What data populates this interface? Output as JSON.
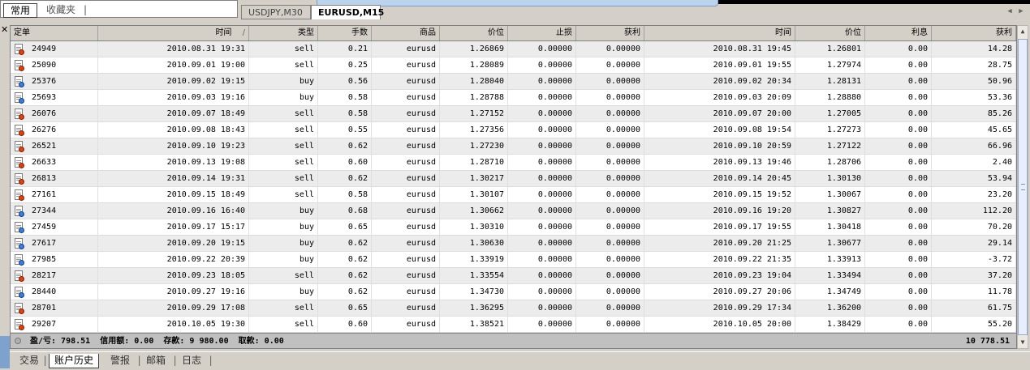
{
  "favorites_panel": {
    "tabs": [
      {
        "label": "常用"
      },
      {
        "label": "收藏夹"
      }
    ]
  },
  "chart_tabs": [
    {
      "label": "USDJPY,M30"
    },
    {
      "label": "EURUSD,M15"
    }
  ],
  "columns": [
    {
      "label": "定单"
    },
    {
      "label": "时间"
    },
    {
      "label": "类型"
    },
    {
      "label": "手数"
    },
    {
      "label": "商品"
    },
    {
      "label": "价位"
    },
    {
      "label": "止损"
    },
    {
      "label": "获利"
    },
    {
      "label": "时间"
    },
    {
      "label": "价位"
    },
    {
      "label": "利息"
    },
    {
      "label": "获利"
    }
  ],
  "sort_indicator": "/",
  "rows": [
    {
      "ticket": "24949",
      "open_time": "2010.08.31 19:31",
      "type": "sell",
      "lots": "0.21",
      "symbol": "eurusd",
      "open_price": "1.26869",
      "sl": "0.00000",
      "tp": "0.00000",
      "close_time": "2010.08.31 19:45",
      "close_price": "1.26801",
      "swap": "0.00",
      "profit": "14.28"
    },
    {
      "ticket": "25090",
      "open_time": "2010.09.01 19:00",
      "type": "sell",
      "lots": "0.25",
      "symbol": "eurusd",
      "open_price": "1.28089",
      "sl": "0.00000",
      "tp": "0.00000",
      "close_time": "2010.09.01 19:55",
      "close_price": "1.27974",
      "swap": "0.00",
      "profit": "28.75"
    },
    {
      "ticket": "25376",
      "open_time": "2010.09.02 19:15",
      "type": "buy",
      "lots": "0.56",
      "symbol": "eurusd",
      "open_price": "1.28040",
      "sl": "0.00000",
      "tp": "0.00000",
      "close_time": "2010.09.02 20:34",
      "close_price": "1.28131",
      "swap": "0.00",
      "profit": "50.96"
    },
    {
      "ticket": "25693",
      "open_time": "2010.09.03 19:16",
      "type": "buy",
      "lots": "0.58",
      "symbol": "eurusd",
      "open_price": "1.28788",
      "sl": "0.00000",
      "tp": "0.00000",
      "close_time": "2010.09.03 20:09",
      "close_price": "1.28880",
      "swap": "0.00",
      "profit": "53.36"
    },
    {
      "ticket": "26076",
      "open_time": "2010.09.07 18:49",
      "type": "sell",
      "lots": "0.58",
      "symbol": "eurusd",
      "open_price": "1.27152",
      "sl": "0.00000",
      "tp": "0.00000",
      "close_time": "2010.09.07 20:00",
      "close_price": "1.27005",
      "swap": "0.00",
      "profit": "85.26"
    },
    {
      "ticket": "26276",
      "open_time": "2010.09.08 18:43",
      "type": "sell",
      "lots": "0.55",
      "symbol": "eurusd",
      "open_price": "1.27356",
      "sl": "0.00000",
      "tp": "0.00000",
      "close_time": "2010.09.08 19:54",
      "close_price": "1.27273",
      "swap": "0.00",
      "profit": "45.65"
    },
    {
      "ticket": "26521",
      "open_time": "2010.09.10 19:23",
      "type": "sell",
      "lots": "0.62",
      "symbol": "eurusd",
      "open_price": "1.27230",
      "sl": "0.00000",
      "tp": "0.00000",
      "close_time": "2010.09.10 20:59",
      "close_price": "1.27122",
      "swap": "0.00",
      "profit": "66.96"
    },
    {
      "ticket": "26633",
      "open_time": "2010.09.13 19:08",
      "type": "sell",
      "lots": "0.60",
      "symbol": "eurusd",
      "open_price": "1.28710",
      "sl": "0.00000",
      "tp": "0.00000",
      "close_time": "2010.09.13 19:46",
      "close_price": "1.28706",
      "swap": "0.00",
      "profit": "2.40"
    },
    {
      "ticket": "26813",
      "open_time": "2010.09.14 19:31",
      "type": "sell",
      "lots": "0.62",
      "symbol": "eurusd",
      "open_price": "1.30217",
      "sl": "0.00000",
      "tp": "0.00000",
      "close_time": "2010.09.14 20:45",
      "close_price": "1.30130",
      "swap": "0.00",
      "profit": "53.94"
    },
    {
      "ticket": "27161",
      "open_time": "2010.09.15 18:49",
      "type": "sell",
      "lots": "0.58",
      "symbol": "eurusd",
      "open_price": "1.30107",
      "sl": "0.00000",
      "tp": "0.00000",
      "close_time": "2010.09.15 19:52",
      "close_price": "1.30067",
      "swap": "0.00",
      "profit": "23.20"
    },
    {
      "ticket": "27344",
      "open_time": "2010.09.16 16:40",
      "type": "buy",
      "lots": "0.68",
      "symbol": "eurusd",
      "open_price": "1.30662",
      "sl": "0.00000",
      "tp": "0.00000",
      "close_time": "2010.09.16 19:20",
      "close_price": "1.30827",
      "swap": "0.00",
      "profit": "112.20"
    },
    {
      "ticket": "27459",
      "open_time": "2010.09.17 15:17",
      "type": "buy",
      "lots": "0.65",
      "symbol": "eurusd",
      "open_price": "1.30310",
      "sl": "0.00000",
      "tp": "0.00000",
      "close_time": "2010.09.17 19:55",
      "close_price": "1.30418",
      "swap": "0.00",
      "profit": "70.20"
    },
    {
      "ticket": "27617",
      "open_time": "2010.09.20 19:15",
      "type": "buy",
      "lots": "0.62",
      "symbol": "eurusd",
      "open_price": "1.30630",
      "sl": "0.00000",
      "tp": "0.00000",
      "close_time": "2010.09.20 21:25",
      "close_price": "1.30677",
      "swap": "0.00",
      "profit": "29.14"
    },
    {
      "ticket": "27985",
      "open_time": "2010.09.22 20:39",
      "type": "buy",
      "lots": "0.62",
      "symbol": "eurusd",
      "open_price": "1.33919",
      "sl": "0.00000",
      "tp": "0.00000",
      "close_time": "2010.09.22 21:35",
      "close_price": "1.33913",
      "swap": "0.00",
      "profit": "-3.72"
    },
    {
      "ticket": "28217",
      "open_time": "2010.09.23 18:05",
      "type": "sell",
      "lots": "0.62",
      "symbol": "eurusd",
      "open_price": "1.33554",
      "sl": "0.00000",
      "tp": "0.00000",
      "close_time": "2010.09.23 19:04",
      "close_price": "1.33494",
      "swap": "0.00",
      "profit": "37.20"
    },
    {
      "ticket": "28440",
      "open_time": "2010.09.27 19:16",
      "type": "buy",
      "lots": "0.62",
      "symbol": "eurusd",
      "open_price": "1.34730",
      "sl": "0.00000",
      "tp": "0.00000",
      "close_time": "2010.09.27 20:06",
      "close_price": "1.34749",
      "swap": "0.00",
      "profit": "11.78"
    },
    {
      "ticket": "28701",
      "open_time": "2010.09.29 17:08",
      "type": "sell",
      "lots": "0.65",
      "symbol": "eurusd",
      "open_price": "1.36295",
      "sl": "0.00000",
      "tp": "0.00000",
      "close_time": "2010.09.29 17:34",
      "close_price": "1.36200",
      "swap": "0.00",
      "profit": "61.75"
    },
    {
      "ticket": "29207",
      "open_time": "2010.10.05 19:30",
      "type": "sell",
      "lots": "0.60",
      "symbol": "eurusd",
      "open_price": "1.38521",
      "sl": "0.00000",
      "tp": "0.00000",
      "close_time": "2010.10.05 20:00",
      "close_price": "1.38429",
      "swap": "0.00",
      "profit": "55.20"
    }
  ],
  "summary": {
    "text": "盈/亏: 798.51  信用额: 0.00  存款: 9 980.00  取款: 0.00",
    "total": "10 778.51"
  },
  "bottom_tabs": [
    {
      "label": "交易"
    },
    {
      "label": "账户历史"
    },
    {
      "label": "警报"
    },
    {
      "label": "邮箱"
    },
    {
      "label": "日志"
    }
  ],
  "colors": {
    "sell_icon": "#e04010",
    "buy_icon": "#3a7ee0",
    "panel_bg": "#d4d0c8"
  },
  "icons": {
    "close": "close-icon",
    "order_sell": "sell-order-icon",
    "order_buy": "buy-order-icon"
  }
}
